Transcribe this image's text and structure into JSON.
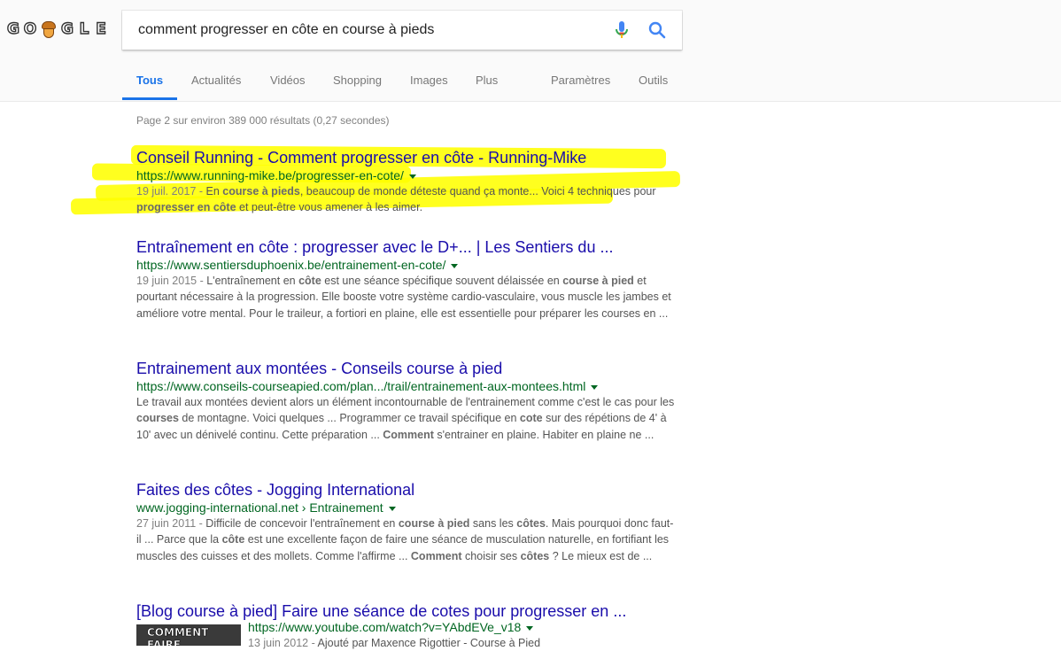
{
  "header": {
    "logo_letters": [
      "G",
      "O",
      "O",
      "G",
      "L",
      "E"
    ],
    "search_query": "comment progresser en côte en course à pieds",
    "icons": [
      "microphone-icon",
      "search-icon"
    ]
  },
  "tabs": [
    {
      "label": "Tous",
      "active": true
    },
    {
      "label": "Actualités"
    },
    {
      "label": "Vidéos"
    },
    {
      "label": "Shopping"
    },
    {
      "label": "Images"
    },
    {
      "label": "Plus"
    },
    {
      "label": "Paramètres"
    },
    {
      "label": "Outils"
    }
  ],
  "stats": "Page 2 sur environ 389 000 résultats (0,27 secondes)",
  "results": [
    {
      "title": "Conseil Running - Comment progresser en côte - Running-Mike",
      "url": "https://www.running-mike.be/progresser-en-cote/",
      "date": "19 juil. 2017 - ",
      "snippet_html": "En <b>course à pieds</b>, beaucoup de monde déteste quand ça monte... Voici 4 techniques pour <b>progresser en côte</b> et peut-être vous amener à les aimer.",
      "highlighted": true
    },
    {
      "title": "Entraînement en côte : progresser avec le D+... | Les Sentiers du ...",
      "url": "https://www.sentiersduphoenix.be/entrainement-en-cote/",
      "date": "19 juin 2015 - ",
      "snippet_html": "L'entraînement en <b>côte</b> est une séance spécifique souvent délaissée en <b>course à pied</b> et pourtant nécessaire à la progression. Elle booste votre système cardio-vasculaire, vous muscle les jambes et améliore votre mental. Pour le traileur, a fortiori en plaine, elle est essentielle pour préparer les courses en ..."
    },
    {
      "title": "Entrainement aux montées - Conseils course à pied",
      "url": "https://www.conseils-courseapied.com/plan.../trail/entrainement-aux-montees.html",
      "date": "",
      "snippet_html": "Le travail aux montées devient alors un élément incontournable de l'entrainement comme c'est le cas pour les <b>courses</b> de montagne. Voici quelques ... Programmer ce travail spécifique en <b>cote</b> sur des répétions de 4' à 10' avec un dénivelé continu. Cette préparation ... <b>Comment</b> s'entrainer en plaine. Habiter en plaine ne ..."
    },
    {
      "title": "Faites des côtes - Jogging International",
      "url": "www.jogging-international.net › Entrainement",
      "date": "27 juin 2011 - ",
      "snippet_html": "Difficile de concevoir l'entraînement en <b>course à pied</b> sans les <b>côtes</b>. Mais pourquoi donc faut-il ... Parce que la <b>côte</b> est une excellente façon de faire une séance de musculation naturelle, en fortifiant les muscles des cuisses et des mollets. Comme l'affirme ... <b>Comment</b> choisir ses <b>côtes</b> ? Le mieux est de ..."
    },
    {
      "title": "[Blog course à pied] Faire une séance de cotes pour progresser en ...",
      "url": "https://www.youtube.com/watch?v=YAbdEVe_v18",
      "date": "13 juin 2012 - ",
      "snippet_html": "Ajouté par Maxence Rigottier - Course à Pied",
      "thumbnail_text": "COMMENT FAIRE"
    }
  ],
  "colors": {
    "link": "#1a0dab",
    "url": "#006621",
    "active_tab": "#1a73e8",
    "highlight": "#ffff00"
  }
}
